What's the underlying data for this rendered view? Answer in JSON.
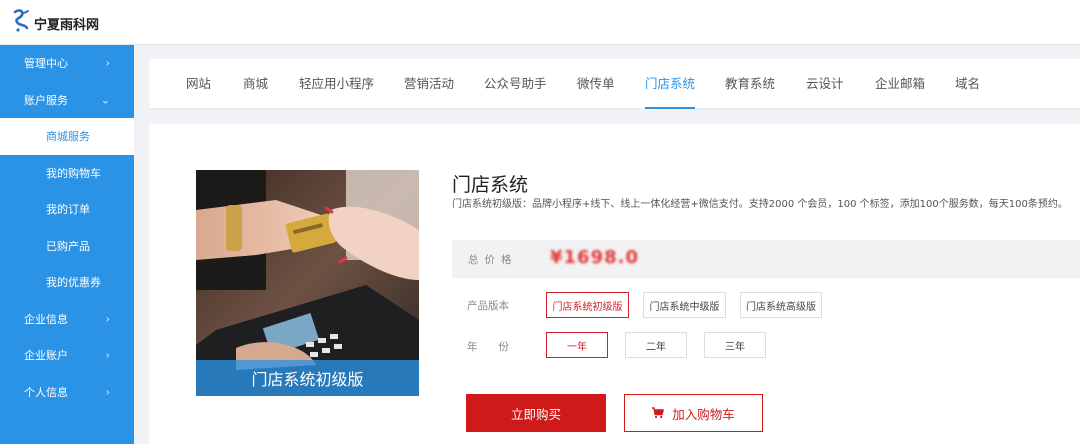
{
  "header": {
    "logo_text": "宁夏雨科网"
  },
  "sidebar": {
    "items": [
      {
        "label": "管理中心",
        "chevron": "›"
      },
      {
        "label": "账户服务",
        "chevron": "⌄"
      },
      {
        "label": "商城服务"
      },
      {
        "label": "我的购物车"
      },
      {
        "label": "我的订单"
      },
      {
        "label": "已购产品"
      },
      {
        "label": "我的优惠券"
      },
      {
        "label": "企业信息",
        "chevron": "›"
      },
      {
        "label": "企业账户",
        "chevron": "›"
      },
      {
        "label": "个人信息",
        "chevron": "›"
      }
    ]
  },
  "tabs": [
    {
      "label": "网站"
    },
    {
      "label": "商城"
    },
    {
      "label": "轻应用小程序"
    },
    {
      "label": "营销活动"
    },
    {
      "label": "公众号助手"
    },
    {
      "label": "微传单"
    },
    {
      "label": "门店系统"
    },
    {
      "label": "教育系统"
    },
    {
      "label": "云设计"
    },
    {
      "label": "企业邮箱"
    },
    {
      "label": "域名"
    }
  ],
  "product": {
    "image_caption": "门店系统初级版",
    "title": "门店系统",
    "description": "门店系统初级版：品牌小程序+线下、线上一体化经营+微信支付。支持2000 个会员，100 个标签，添加100个服务数，每天100条预约。",
    "price_label": "总价格",
    "price_value": "¥1698.0",
    "version_label": "产品版本",
    "versions": [
      "门店系统初级版",
      "门店系统中级版",
      "门店系统高级版"
    ],
    "year_label": "年　　份",
    "years": [
      "一年",
      "二年",
      "三年"
    ],
    "buy_label": "立即购买",
    "cart_label": "加入购物车"
  },
  "colors": {
    "brand": "#2b93e6",
    "accent_red": "#cf1a1a"
  },
  "icons": {
    "logo": "ys-logo-icon",
    "cart": "cart-icon"
  }
}
